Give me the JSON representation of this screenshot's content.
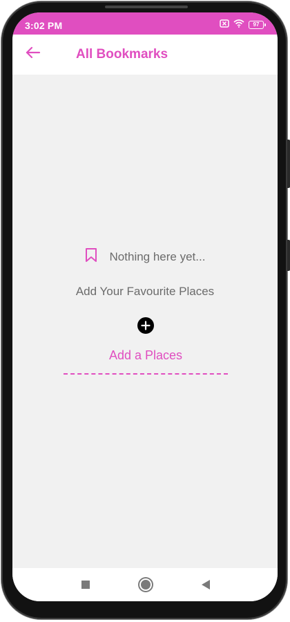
{
  "status_bar": {
    "time": "3:02 PM",
    "battery_level": "97",
    "icons": [
      "sim-off-icon",
      "wifi-icon",
      "battery-icon"
    ]
  },
  "app_bar": {
    "title": "All Bookmarks",
    "back_icon": "arrow-left-icon"
  },
  "empty_state": {
    "icon": "bookmark-icon",
    "message": "Nothing here yet...",
    "subtitle": "Add Your Favourite Places",
    "add_icon": "plus-circle-icon",
    "add_link_label": "Add a Places"
  },
  "nav_bar": {
    "buttons": [
      "recents-square-icon",
      "home-circle-icon",
      "back-triangle-icon"
    ]
  },
  "colors": {
    "accent": "#e04ec0",
    "background": "#f1f1f1",
    "text_secondary": "#6b6b6b"
  }
}
